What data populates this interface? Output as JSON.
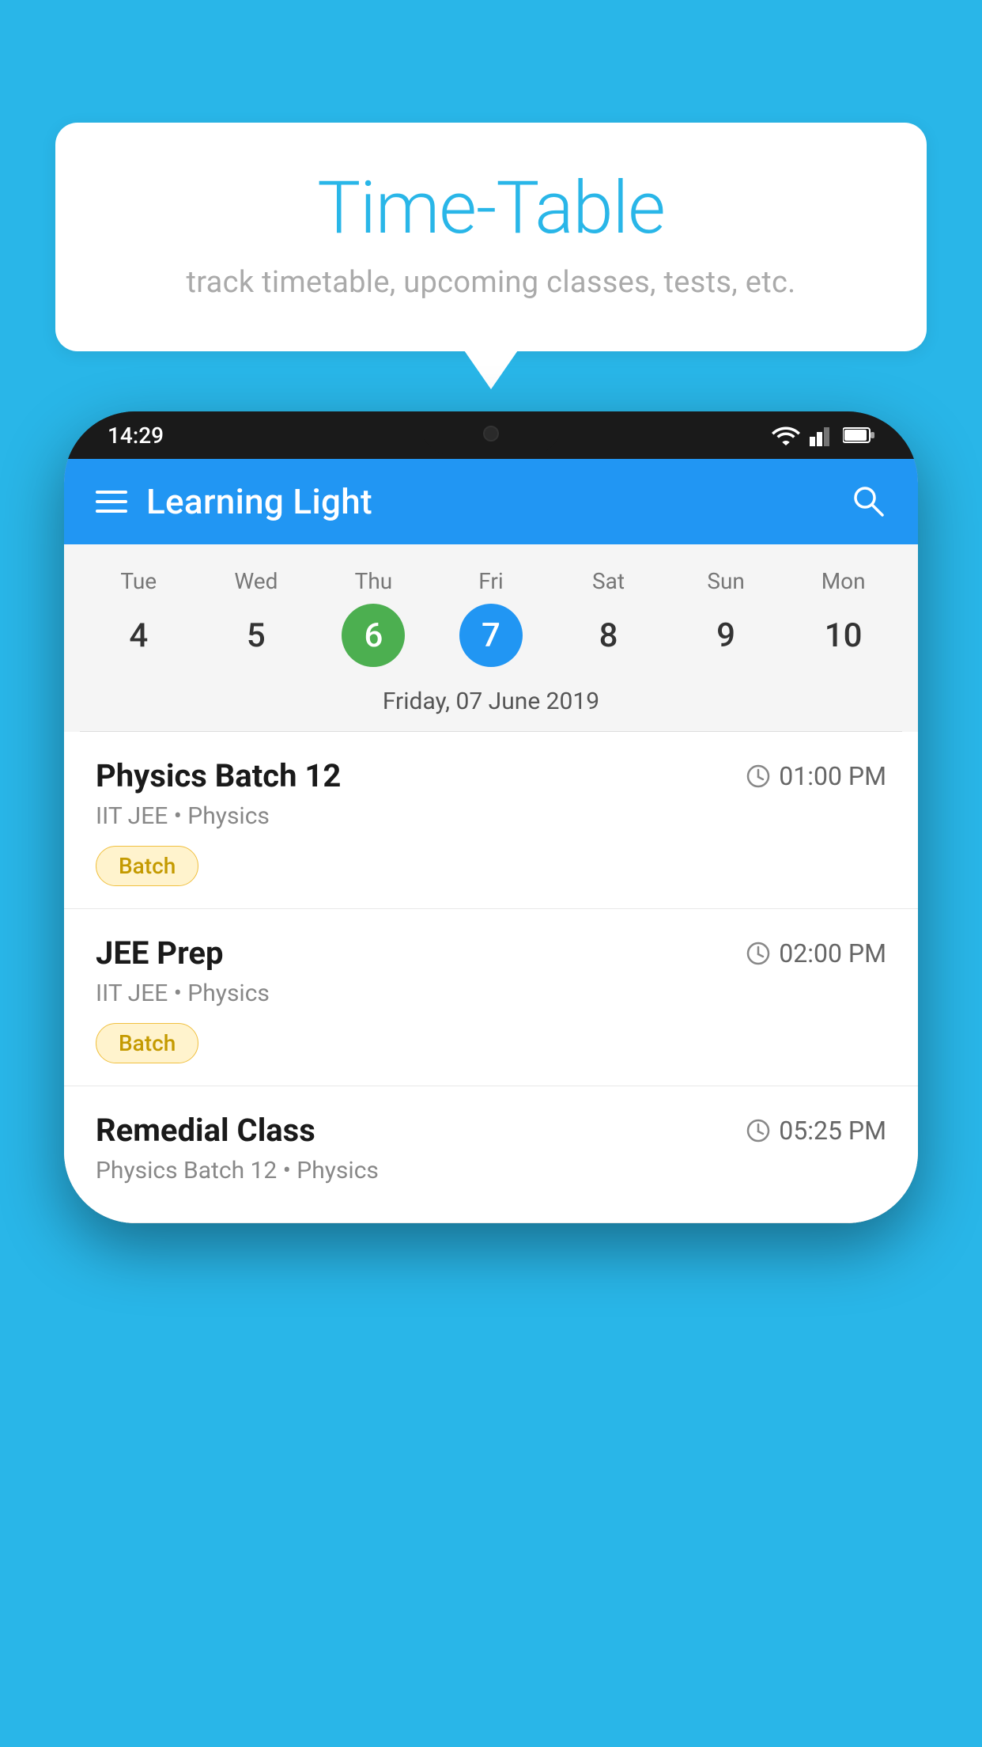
{
  "background_color": "#29b6e8",
  "bubble": {
    "title": "Time-Table",
    "subtitle": "track timetable, upcoming classes, tests, etc."
  },
  "phone": {
    "status_bar": {
      "time": "14:29"
    },
    "toolbar": {
      "app_name": "Learning Light"
    },
    "calendar": {
      "selected_date_label": "Friday, 07 June 2019",
      "days": [
        {
          "label": "Tue",
          "number": "4",
          "state": "normal"
        },
        {
          "label": "Wed",
          "number": "5",
          "state": "normal"
        },
        {
          "label": "Thu",
          "number": "6",
          "state": "today"
        },
        {
          "label": "Fri",
          "number": "7",
          "state": "selected"
        },
        {
          "label": "Sat",
          "number": "8",
          "state": "normal"
        },
        {
          "label": "Sun",
          "number": "9",
          "state": "normal"
        },
        {
          "label": "Mon",
          "number": "10",
          "state": "normal"
        }
      ]
    },
    "schedule": {
      "items": [
        {
          "title": "Physics Batch 12",
          "time": "01:00 PM",
          "subtitle": "IIT JEE • Physics",
          "badge": "Batch"
        },
        {
          "title": "JEE Prep",
          "time": "02:00 PM",
          "subtitle": "IIT JEE • Physics",
          "badge": "Batch"
        },
        {
          "title": "Remedial Class",
          "time": "05:25 PM",
          "subtitle": "Physics Batch 12 • Physics",
          "badge": null
        }
      ]
    }
  }
}
